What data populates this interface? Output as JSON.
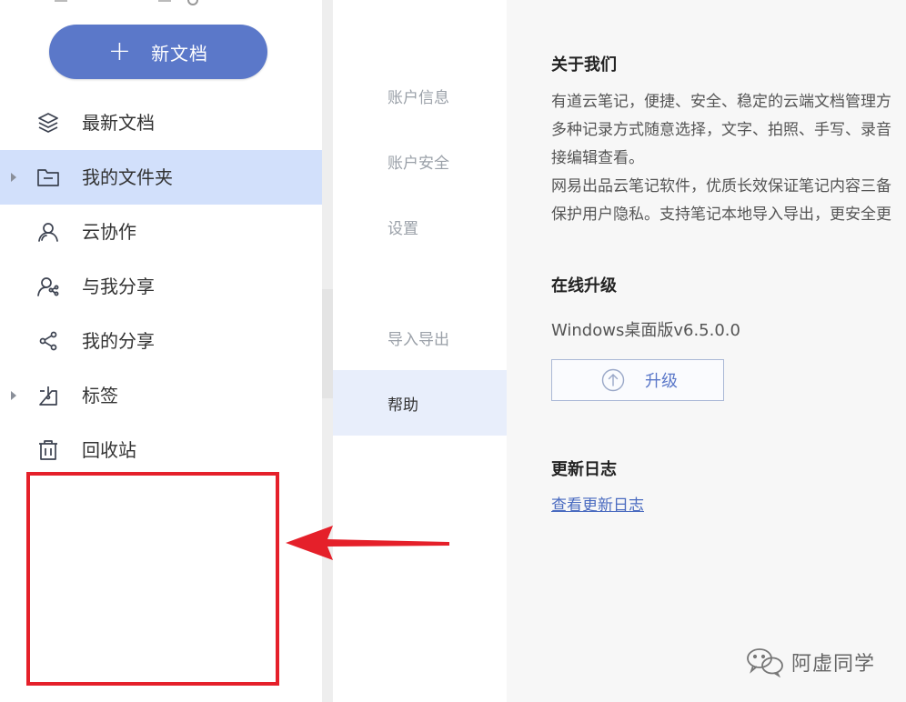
{
  "sidebar": {
    "new_doc_label": "新文档",
    "items": [
      {
        "label": "最新文档",
        "icon": "layers-icon"
      },
      {
        "label": "我的文件夹",
        "icon": "folder-icon",
        "active": true,
        "expandable": true
      },
      {
        "label": "云协作",
        "icon": "user-icon"
      },
      {
        "label": "与我分享",
        "icon": "shared-with-me-icon"
      },
      {
        "label": "我的分享",
        "icon": "share-icon"
      },
      {
        "label": "标签",
        "icon": "tag-icon",
        "expandable": true
      },
      {
        "label": "回收站",
        "icon": "trash-icon"
      }
    ]
  },
  "settings_nav": {
    "items": [
      "账户信息",
      "账户安全",
      "设置",
      "导入导出",
      "帮助"
    ],
    "active": "帮助"
  },
  "content": {
    "about": {
      "title": "关于我们",
      "lines": [
        "有道云笔记，便捷、安全、稳定的云端文档管理方",
        "多种记录方式随意选择，文字、拍照、手写、录音",
        "接编辑查看。",
        "网易出品云笔记软件，优质长效保证笔记内容三备",
        "保护用户隐私。支持笔记本地导入导出，更安全更"
      ]
    },
    "upgrade": {
      "title": "在线升级",
      "version": "Windows桌面版v6.5.0.0",
      "button_label": "升级"
    },
    "changelog": {
      "title": "更新日志",
      "link_label": "查看更新日志"
    }
  },
  "watermark": "阿虚同学",
  "colors": {
    "accent": "#5b78c9",
    "active_bg": "#d2e0fb",
    "annotation_red": "#e5202a"
  }
}
